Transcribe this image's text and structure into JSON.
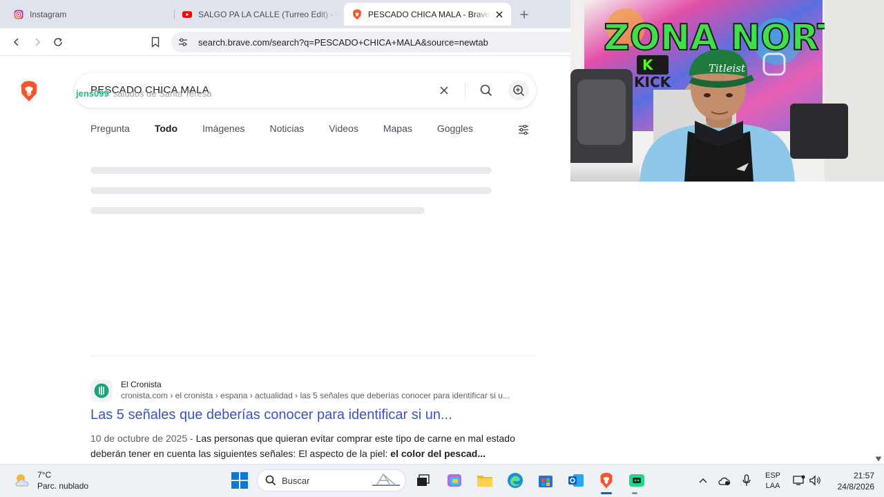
{
  "browser": {
    "tabs": [
      {
        "title": "Instagram",
        "icon": "instagram-icon"
      },
      {
        "title": "SALGO PA LA CALLE (Turreo Edit) - C",
        "icon": "youtube-icon"
      },
      {
        "title": "PESCADO CHICA MALA - Brave S",
        "icon": "brave-icon",
        "active": true
      }
    ],
    "address": "search.brave.com/search?q=PESCADO+CHICA+MALA&source=newtab"
  },
  "search": {
    "query": "PESCADO CHICA MALA",
    "overlay_user": "jens099",
    "overlay_message": "saludos de Santa Teresa",
    "tabs": [
      "Pregunta",
      "Todo",
      "Imágenes",
      "Noticias",
      "Videos",
      "Mapas",
      "Goggles"
    ],
    "active_tab": "Todo"
  },
  "result": {
    "site": "El Cronista",
    "breadcrumb": "cronista.com › el cronista › espana › actualidad › las 5 señales que deberías conocer para identificar si u...",
    "title": "Las 5 señales que deberías conocer para identificar si un...",
    "date": "10 de octubre de 2025",
    "snippet_sep": " - ",
    "snippet": "Las personas que quieran evitar comprar este tipo de carne en mal estado deberán tener en cuenta las siguientes señales: El aspecto de la piel: ",
    "snippet_bold": "el color del pescad..."
  },
  "webcam": {
    "wall_text": "ZONA NORTE",
    "kick_text": "KICK",
    "cap_text": "Titleist"
  },
  "taskbar": {
    "weather_temp": "7°C",
    "weather_desc": "Parc. nublado",
    "search_label": "Buscar",
    "lang_line1": "ESP",
    "lang_line2": "LAA",
    "time": "21:57",
    "date": "24/8/2026"
  },
  "colors": {
    "brave_orange": "#fb542b",
    "link_blue": "#3c52c8",
    "tab_strip": "#dfe3eb",
    "taskbar": "#eef1f5"
  }
}
